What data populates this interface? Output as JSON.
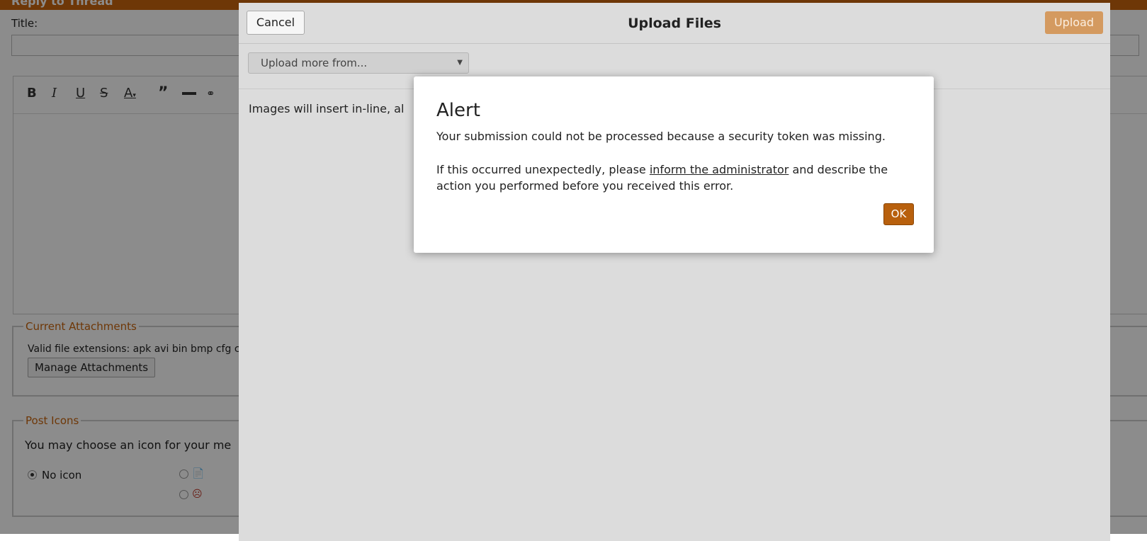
{
  "background": {
    "heading": "Reply to Thread",
    "title_label": "Title:",
    "attachments": {
      "legend": "Current Attachments",
      "extensions_text": "Valid file extensions: apk avi bin bmp cfg c",
      "manage_button": "Manage Attachments"
    },
    "post_icons": {
      "legend": "Post Icons",
      "prompt": "You may choose an icon for your me",
      "no_icon_label": "No icon"
    }
  },
  "upload_dialog": {
    "cancel": "Cancel",
    "title": "Upload Files",
    "upload": "Upload",
    "source_select": "Upload more from...",
    "body_text": "Images will insert in-line, al"
  },
  "alert": {
    "title": "Alert",
    "message": "Your submission could not be processed because a security token was missing.",
    "help_prefix": "If this occurred unexpectedly, please ",
    "help_link": "inform the administrator",
    "help_suffix": " and describe the action you performed before you received this error.",
    "ok": "OK"
  }
}
